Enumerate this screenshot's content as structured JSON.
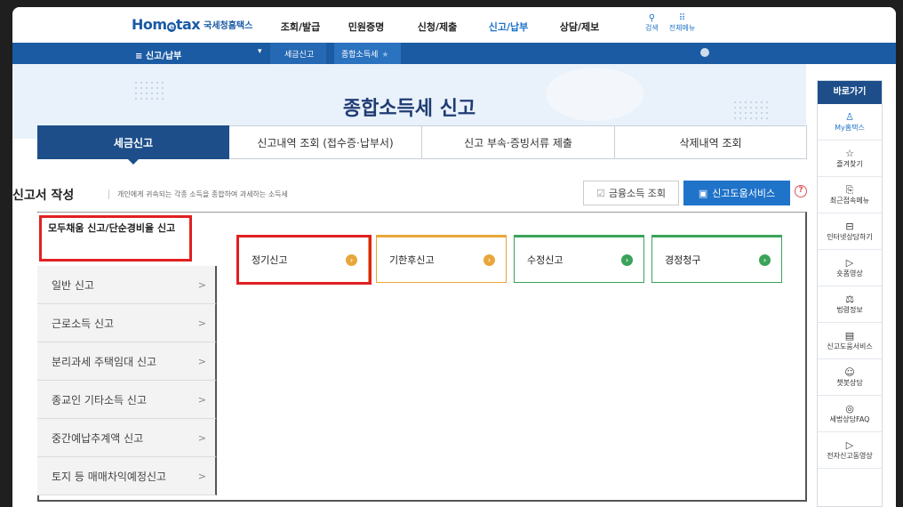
{
  "header": {
    "logo_text": "Hom",
    "logo_e": "e",
    "logo_text2": "tax",
    "logo_sub": "국세청홈택스",
    "menu": [
      "조회/발급",
      "민원증명",
      "신청/제출",
      "신고/납부",
      "상담/제보"
    ],
    "active_menu": "신고/납부",
    "util": [
      {
        "icon": "search-icon",
        "label": "검색"
      },
      {
        "icon": "grid-menu-icon",
        "label": "전체메뉴"
      }
    ]
  },
  "breadcrumb": {
    "home": "≡  신고/납부",
    "level1": "세금신고",
    "level2": "종합소득세"
  },
  "hero": {
    "title": "종합소득세 신고"
  },
  "tabs": [
    "세금신고",
    "신고내역 조회 (접수증·납부서)",
    "신고 부속·증빙서류 제출",
    "삭제내역 조회"
  ],
  "section": {
    "title": "신고서 작성",
    "desc": "개인에게 귀속되는 각종 소득을 종합하여 과세하는 소득세",
    "btn_financial": "금융소득 조회",
    "btn_help": "신고도움서비스",
    "help_q": "?"
  },
  "leftnav": {
    "first": "모두채움 신고/단순경비율 신고",
    "items": [
      "일반 신고",
      "근로소득 신고",
      "분리과세 주택임대 신고",
      "종교인 기타소득 신고",
      "중간예납추계액 신고",
      "토지 등 매매차익예정신고"
    ]
  },
  "cards": [
    {
      "label": "정기신고",
      "color": "#e8a63a"
    },
    {
      "label": "기한후신고",
      "color": "#e8a63a"
    },
    {
      "label": "수정신고",
      "color": "#3aa35a"
    },
    {
      "label": "경정청구",
      "color": "#3aa35a"
    }
  ],
  "quickbar": {
    "title": "바로가기",
    "items": [
      {
        "icon": "person-icon",
        "label": "My홈택스"
      },
      {
        "icon": "star-icon",
        "label": "즐겨찾기"
      },
      {
        "icon": "history-icon",
        "label": "최근접속메뉴"
      },
      {
        "icon": "monitor-icon",
        "label": "인터넷상담하기"
      },
      {
        "icon": "play-icon",
        "label": "숏폼영상"
      },
      {
        "icon": "gavel-icon",
        "label": "법령정보"
      },
      {
        "icon": "book-icon",
        "label": "신고도움서비스"
      },
      {
        "icon": "chatbot-icon",
        "label": "챗봇상담"
      },
      {
        "icon": "faq-icon",
        "label": "세법상담FAQ"
      },
      {
        "icon": "video-icon",
        "label": "전자신고동영상"
      }
    ]
  }
}
